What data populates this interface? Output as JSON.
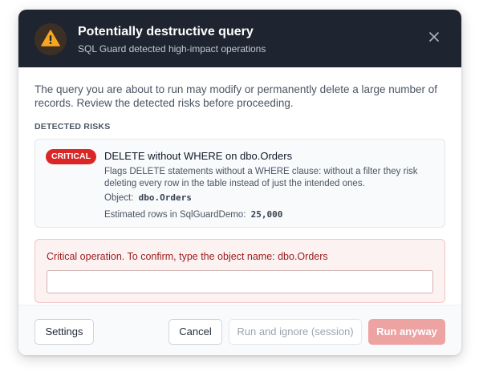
{
  "dialog": {
    "title": "Potentially destructive query",
    "subtitle": "SQL Guard detected high-impact operations",
    "icon": "warning-icon",
    "close_icon": "close-icon"
  },
  "intro": "The query you are about to run may modify or permanently delete a large number of records. Review the detected risks before proceeding.",
  "risks": {
    "section_label": "DETECTED RISKS",
    "items": [
      {
        "severity": "CRITICAL",
        "title": "DELETE without WHERE on dbo.Orders",
        "description": "Flags DELETE statements without a WHERE clause: without a filter they risk deleting every row in the table instead of just the intended ones.",
        "object_label": "Object:",
        "object_value": "dbo.Orders",
        "rows_label": "Estimated rows in SqlGuardDemo:",
        "rows_value": "25,000"
      }
    ]
  },
  "confirm": {
    "label": "Critical operation. To confirm, type the object name: dbo.Orders",
    "value": "",
    "placeholder": ""
  },
  "footer": {
    "settings": "Settings",
    "cancel": "Cancel",
    "run_ignore": "Run and ignore (session)",
    "run_anyway": "Run anyway"
  },
  "colors": {
    "header_bg": "#1e2530",
    "critical": "#dc2626",
    "warning": "#f59e0b",
    "run_disabled": "#eea3a3"
  }
}
